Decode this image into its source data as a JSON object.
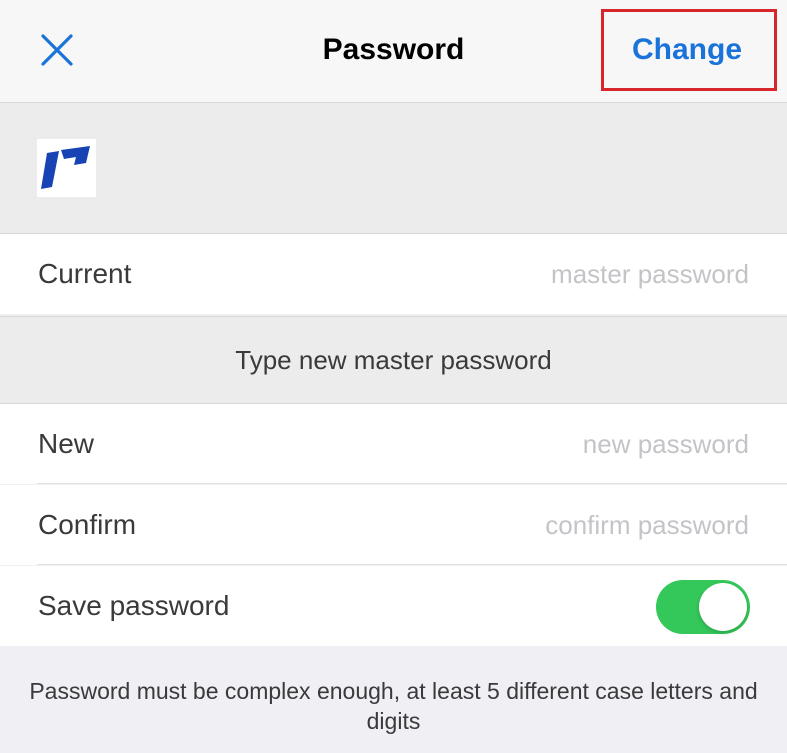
{
  "navbar": {
    "title": "Password",
    "close_icon": "close-icon",
    "change_label": "Change"
  },
  "logo": {
    "icon": "app-logo-icon",
    "brand_color": "#1743b5"
  },
  "current_row": {
    "label": "Current",
    "value": "",
    "placeholder": "master password"
  },
  "new_section": {
    "header": "Type new master password"
  },
  "new_row": {
    "label": "New",
    "value": "",
    "placeholder": "new password"
  },
  "confirm_row": {
    "label": "Confirm",
    "value": "",
    "placeholder": "confirm password"
  },
  "save_row": {
    "label": "Save password",
    "toggle_on": true,
    "toggle_color": "#34c759"
  },
  "footer": {
    "note": "Password must be complex enough, at least 5 different case letters and digits"
  },
  "colors": {
    "accent": "#1a73d9",
    "highlight": "#d6262b"
  }
}
